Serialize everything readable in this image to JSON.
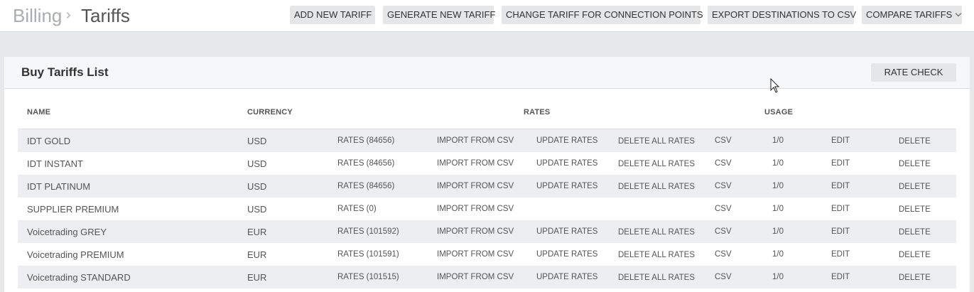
{
  "breadcrumb": {
    "root": "Billing",
    "separator": "›",
    "current": "Tariffs"
  },
  "toolbar": {
    "add_new_tariff": "ADD NEW TARIFF",
    "generate_new_tariff": "GENERATE NEW TARIFF",
    "change_tariff_for_connection_points": "CHANGE TARIFF FOR CONNECTION POINTS",
    "export_destinations_to_csv": "EXPORT DESTINATIONS TO CSV",
    "compare_tariffs": "COMPARE TARIFFS"
  },
  "panel": {
    "title": "Buy Tariffs List",
    "rate_check": "RATE CHECK"
  },
  "table": {
    "headers": {
      "name": "NAME",
      "currency": "CURRENCY",
      "rates": "RATES",
      "usage": "USAGE"
    },
    "rows": [
      {
        "name": "IDT GOLD",
        "currency": "USD",
        "rates": "RATES (84656)",
        "import": "IMPORT FROM CSV",
        "update": "UPDATE RATES",
        "delete_all": "DELETE ALL RATES",
        "csv": "CSV",
        "usage": "1/0",
        "edit": "EDIT",
        "delete": "DELETE"
      },
      {
        "name": "IDT INSTANT",
        "currency": "USD",
        "rates": "RATES (84656)",
        "import": "IMPORT FROM CSV",
        "update": "UPDATE RATES",
        "delete_all": "DELETE ALL RATES",
        "csv": "CSV",
        "usage": "1/0",
        "edit": "EDIT",
        "delete": "DELETE"
      },
      {
        "name": "IDT PLATINUM",
        "currency": "USD",
        "rates": "RATES (84656)",
        "import": "IMPORT FROM CSV",
        "update": "UPDATE RATES",
        "delete_all": "DELETE ALL RATES",
        "csv": "CSV",
        "usage": "1/0",
        "edit": "EDIT",
        "delete": "DELETE"
      },
      {
        "name": "SUPPLIER PREMIUM",
        "currency": "USD",
        "rates": "RATES (0)",
        "import": "IMPORT FROM CSV",
        "update": "",
        "delete_all": "",
        "csv": "CSV",
        "usage": "1/0",
        "edit": "EDIT",
        "delete": "DELETE"
      },
      {
        "name": "Voicetrading GREY",
        "currency": "EUR",
        "rates": "RATES (101592)",
        "import": "IMPORT FROM CSV",
        "update": "UPDATE RATES",
        "delete_all": "DELETE ALL RATES",
        "csv": "CSV",
        "usage": "1/0",
        "edit": "EDIT",
        "delete": "DELETE"
      },
      {
        "name": "Voicetrading PREMIUM",
        "currency": "EUR",
        "rates": "RATES (101591)",
        "import": "IMPORT FROM CSV",
        "update": "UPDATE RATES",
        "delete_all": "DELETE ALL RATES",
        "csv": "CSV",
        "usage": "1/0",
        "edit": "EDIT",
        "delete": "DELETE"
      },
      {
        "name": "Voicetrading STANDARD",
        "currency": "EUR",
        "rates": "RATES (101515)",
        "import": "IMPORT FROM CSV",
        "update": "UPDATE RATES",
        "delete_all": "DELETE ALL RATES",
        "csv": "CSV",
        "usage": "1/0",
        "edit": "EDIT",
        "delete": "DELETE"
      }
    ]
  },
  "icons": {
    "compare_dropdown": "chevron-down-icon",
    "pointer": "mouse-cursor-icon"
  },
  "colors": {
    "button_bg": "#e4e6e8",
    "alt_row_bg": "#eceef1",
    "page_bg": "#e6e8ea"
  }
}
